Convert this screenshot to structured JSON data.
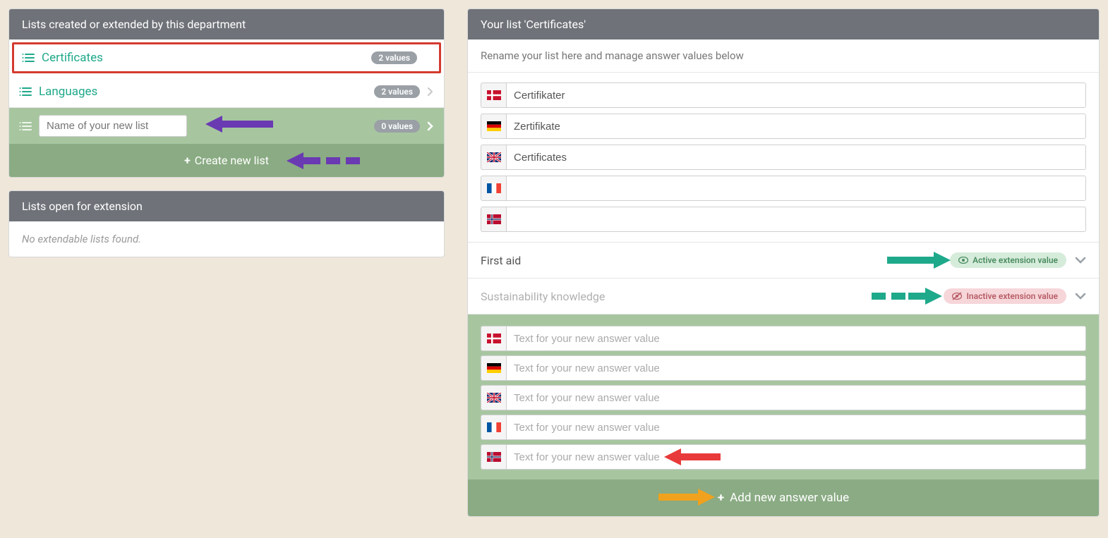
{
  "leftPanel": {
    "header": "Lists created or extended by this department",
    "items": [
      {
        "label": "Certificates",
        "valueCount": "2 values",
        "selected": true
      },
      {
        "label": "Languages",
        "valueCount": "2 values",
        "selected": false
      }
    ],
    "newListPlaceholder": "Name of your new list",
    "newListValueCount": "0 values",
    "createButton": "Create new list"
  },
  "extensionPanel": {
    "header": "Lists open for extension",
    "emptyText": "No extendable lists found."
  },
  "rightPanel": {
    "header": "Your list 'Certificates'",
    "instructions": "Rename your list here and manage answer values below",
    "renameFields": [
      {
        "flag": "dk",
        "value": "Certifikater"
      },
      {
        "flag": "de",
        "value": "Zertifikate"
      },
      {
        "flag": "uk",
        "value": "Certificates"
      },
      {
        "flag": "fr",
        "value": ""
      },
      {
        "flag": "no",
        "value": ""
      }
    ],
    "values": [
      {
        "title": "First aid",
        "status": "active",
        "statusLabel": "Active extension value"
      },
      {
        "title": "Sustainability knowledge",
        "status": "inactive",
        "statusLabel": "Inactive extension value"
      }
    ],
    "newValuePlaceholder": "Text for your new answer value",
    "newValueFlags": [
      "dk",
      "de",
      "uk",
      "fr",
      "no"
    ],
    "addButton": "Add new answer value"
  }
}
